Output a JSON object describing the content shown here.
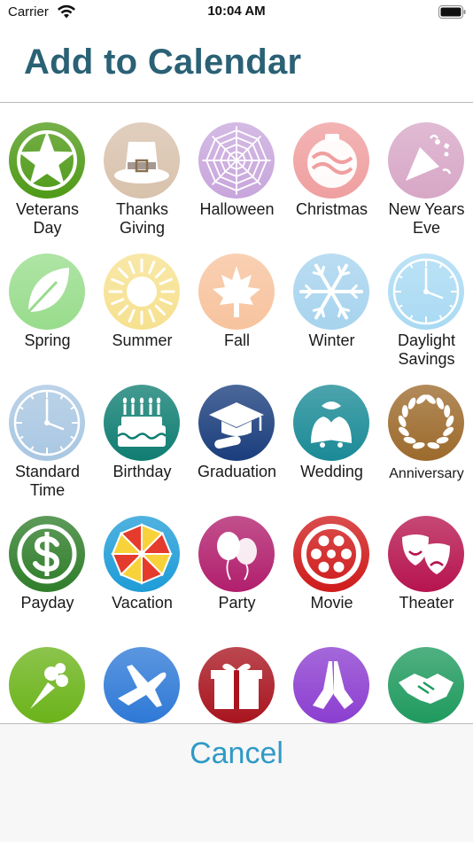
{
  "status": {
    "carrier": "Carrier",
    "time": "10:04 AM"
  },
  "header": {
    "title": "Add to Calendar"
  },
  "events": [
    {
      "label": "Veterans\nDay",
      "icon": "star-icon",
      "color": "#4f9a17"
    },
    {
      "label": "Thanks\nGiving",
      "icon": "pilgrim-hat-icon",
      "color": "#d8c2ac"
    },
    {
      "label": "Halloween",
      "icon": "spider-web-icon",
      "color": "#c8a6dc"
    },
    {
      "label": "Christmas",
      "icon": "candy-ornament-icon",
      "color": "#ef9f9f"
    },
    {
      "label": "New Years\nEve",
      "icon": "party-popper-icon",
      "color": "#d7a7c6"
    },
    {
      "label": "Spring",
      "icon": "leaf-icon",
      "color": "#98dc8c"
    },
    {
      "label": "Summer",
      "icon": "sun-icon",
      "color": "#f6e18f"
    },
    {
      "label": "Fall",
      "icon": "maple-leaf-icon",
      "color": "#f7c39e"
    },
    {
      "label": "Winter",
      "icon": "snowflake-icon",
      "color": "#a7d3ee"
    },
    {
      "label": "Daylight\nSavings",
      "icon": "clock-icon",
      "color": "#a9daf3"
    },
    {
      "label": "Standard\nTime",
      "icon": "clock-icon",
      "color": "#a9c7e2"
    },
    {
      "label": "Birthday",
      "icon": "birthday-cake-icon",
      "color": "#0f7d72"
    },
    {
      "label": "Graduation",
      "icon": "graduation-cap-icon",
      "color": "#1a3d7c"
    },
    {
      "label": "Wedding",
      "icon": "wedding-bells-icon",
      "color": "#1a8a96"
    },
    {
      "label": "Anniversary",
      "icon": "laurel-wreath-icon",
      "color": "#9c6a2c"
    },
    {
      "label": "Payday",
      "icon": "dollar-icon",
      "color": "#2f7d2a"
    },
    {
      "label": "Vacation",
      "icon": "beach-umbrella-icon",
      "color": "#1e9cd7"
    },
    {
      "label": "Party",
      "icon": "balloons-icon",
      "color": "#b11e6d"
    },
    {
      "label": "Movie",
      "icon": "film-reel-icon",
      "color": "#cf1b1b"
    },
    {
      "label": "Theater",
      "icon": "theater-masks-icon",
      "color": "#b6144e"
    },
    {
      "label": "",
      "icon": "bouquet-icon",
      "color": "#6bb31a"
    },
    {
      "label": "",
      "icon": "airplane-icon",
      "color": "#2e79d6"
    },
    {
      "label": "",
      "icon": "gift-icon",
      "color": "#a8141e"
    },
    {
      "label": "",
      "icon": "praying-hands-icon",
      "color": "#8b3ed0"
    },
    {
      "label": "",
      "icon": "handshake-icon",
      "color": "#1f9a5e"
    }
  ],
  "footer": {
    "cancel_label": "Cancel"
  }
}
